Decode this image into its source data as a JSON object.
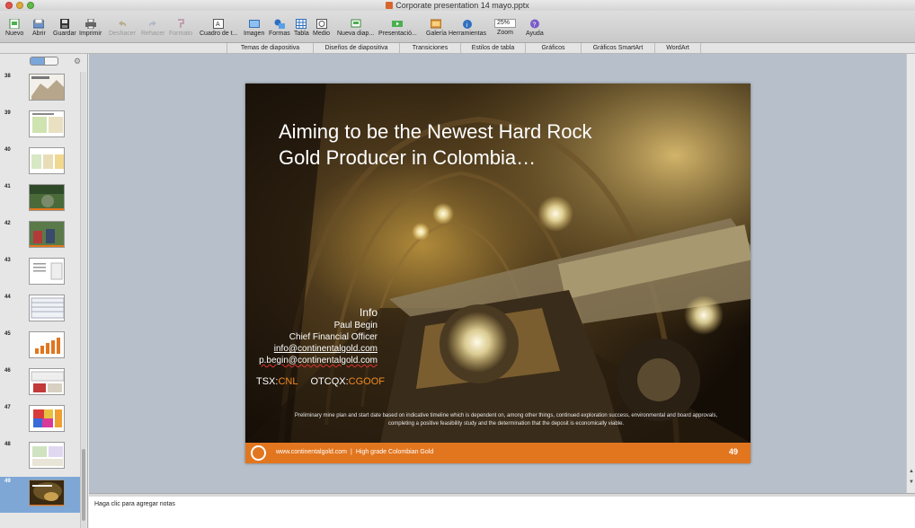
{
  "window": {
    "title": "Corporate presentation 14 mayo.pptx"
  },
  "toolbar": {
    "items": [
      {
        "label": "Nuevo",
        "icon": "new-icon",
        "enabled": true
      },
      {
        "label": "Abrir",
        "icon": "open-icon",
        "enabled": true
      },
      {
        "label": "Guardar",
        "icon": "save-icon",
        "enabled": true
      },
      {
        "label": "Imprimir",
        "icon": "print-icon",
        "enabled": true
      },
      {
        "label": "Deshacer",
        "icon": "undo-icon",
        "enabled": false
      },
      {
        "label": "Rehacer",
        "icon": "redo-icon",
        "enabled": false
      },
      {
        "label": "Formato",
        "icon": "format-painter-icon",
        "enabled": false
      },
      {
        "label": "Cuadro de t...",
        "icon": "text-box-icon",
        "enabled": true
      },
      {
        "label": "Imagen",
        "icon": "image-icon",
        "enabled": true
      },
      {
        "label": "Formas",
        "icon": "shapes-icon",
        "enabled": true
      },
      {
        "label": "Tabla",
        "icon": "table-icon",
        "enabled": true
      },
      {
        "label": "Medio",
        "icon": "media-icon",
        "enabled": true
      },
      {
        "label": "Nueva diap...",
        "icon": "new-slide-icon",
        "enabled": true
      },
      {
        "label": "Presentació...",
        "icon": "slideshow-icon",
        "enabled": true
      },
      {
        "label": "Galería",
        "icon": "gallery-icon",
        "enabled": true
      },
      {
        "label": "Herramientas",
        "icon": "toolbox-icon",
        "enabled": true
      },
      {
        "label": "Zoom",
        "icon": "zoom-icon",
        "enabled": true
      },
      {
        "label": "Ayuda",
        "icon": "help-icon",
        "enabled": true
      }
    ],
    "zoom_value": "25%"
  },
  "ribbon": {
    "tabs": [
      {
        "label": "Temas de diapositiva"
      },
      {
        "label": "Diseños de diapositiva"
      },
      {
        "label": "Transiciones"
      },
      {
        "label": "Estilos de tabla"
      },
      {
        "label": "Gráficos"
      },
      {
        "label": "Gráficos SmartArt"
      },
      {
        "label": "WordArt"
      }
    ]
  },
  "sidebar": {
    "slides": [
      {
        "number": "38",
        "selected": false
      },
      {
        "number": "39",
        "selected": false
      },
      {
        "number": "40",
        "selected": false
      },
      {
        "number": "41",
        "selected": false
      },
      {
        "number": "42",
        "selected": false
      },
      {
        "number": "43",
        "selected": false
      },
      {
        "number": "44",
        "selected": false
      },
      {
        "number": "45",
        "selected": false
      },
      {
        "number": "46",
        "selected": false
      },
      {
        "number": "47",
        "selected": false
      },
      {
        "number": "48",
        "selected": false
      },
      {
        "number": "49",
        "selected": true
      }
    ]
  },
  "slide": {
    "title_line1": "Aiming to be the Newest Hard Rock",
    "title_line2": "Gold Producer in Colombia…",
    "info": {
      "heading": "Info",
      "name": "Paul Begin",
      "role": "Chief Financial Officer",
      "email1": "info@continentalgold.com",
      "email2": "p.begin@continentalgold.com"
    },
    "tickers": {
      "tsx_label": "TSX:",
      "tsx_value": "CNL",
      "otcqx_label": "OTCQX:",
      "otcqx_value": "CGOOF"
    },
    "disclaimer": "Preliminary mine plan and start date based on indicative timeline which is dependent on, among other things, continued exploration success, environmental and board approvals, completing a positive feasibility study and the determination that the deposit is economically viable.",
    "footer": {
      "website": "www.continentalgold.com",
      "separator": "|",
      "tagline": "High grade Colombian Gold",
      "page_number": "49"
    },
    "colors": {
      "accent": "#e2761f",
      "ticker": "#f08a24"
    }
  },
  "notes": {
    "placeholder": "Haga clic para agregar notas"
  }
}
